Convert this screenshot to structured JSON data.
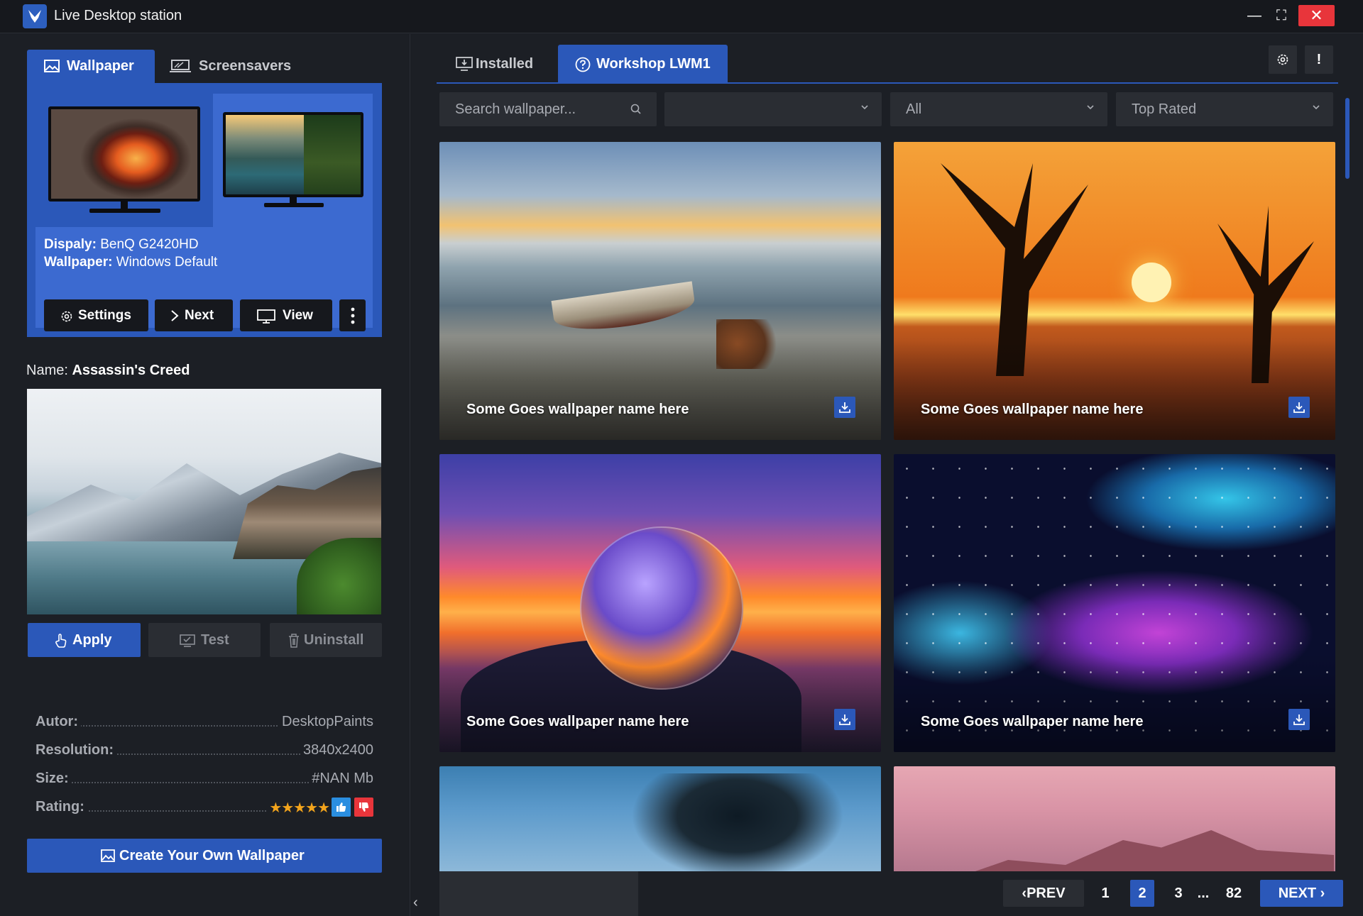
{
  "app": {
    "title": "Live Desktop station",
    "accent_color": "#2b58b9",
    "close_color": "#e8353b"
  },
  "window_controls": {
    "minimize_icon": "minimize-icon",
    "maximize_icon": "maximize-icon",
    "close_icon": "close-icon",
    "minimize_glyph": "—",
    "maximize_glyph": "⛶",
    "close_glyph": "✕"
  },
  "left_tabs": [
    {
      "label": "Wallpaper",
      "icon": "image-icon",
      "active": true
    },
    {
      "label": "Screensavers",
      "icon": "monitor-laptop-icon",
      "active": false
    }
  ],
  "display": {
    "display_key": "Dispaly:",
    "display_value": "BenQ G2420HD",
    "wallpaper_key": "Wallpaper:",
    "wallpaper_value": "Windows Default",
    "buttons": {
      "settings": "Settings",
      "next": "Next",
      "view": "View"
    }
  },
  "selected": {
    "name_key": "Name:",
    "name_value": "Assassin's Creed"
  },
  "actions": {
    "apply": "Apply",
    "test": "Test",
    "uninstall": "Uninstall"
  },
  "meta": {
    "autor_key": "Autor:",
    "autor_value": "DesktopPaints",
    "resolution_key": "Resolution:",
    "resolution_value": "3840x2400",
    "size_key": "Size:",
    "size_value": "#NAN Mb",
    "rating_key": "Rating:",
    "rating_stars": "★★★★★",
    "rating_value": 5
  },
  "create_button": "Create Your Own Wallpaper",
  "right_tabs": [
    {
      "label": "Installed",
      "icon": "monitor-download-icon",
      "active": false
    },
    {
      "label": "Workshop LWM1",
      "icon": "help-circle-icon",
      "active": true
    }
  ],
  "top_buttons": {
    "settings_icon": "gear-icon",
    "alert_label": "!"
  },
  "filters": {
    "search_placeholder": "Search wallpaper...",
    "category_value": "",
    "type_value": "All",
    "sort_value": "Top Rated"
  },
  "cards": [
    {
      "caption": "Some Goes wallpaper name here"
    },
    {
      "caption": "Some Goes wallpaper name here"
    },
    {
      "caption": "Some Goes wallpaper name here"
    },
    {
      "caption": "Some Goes wallpaper name here"
    }
  ],
  "pagination": {
    "prev": "PREV",
    "next": "NEXT",
    "pages": [
      "1",
      "2",
      "3"
    ],
    "ellipsis": "...",
    "last": "82",
    "current": "2",
    "prev_glyph": "‹",
    "next_glyph": "›",
    "collapse_glyph": "‹"
  }
}
